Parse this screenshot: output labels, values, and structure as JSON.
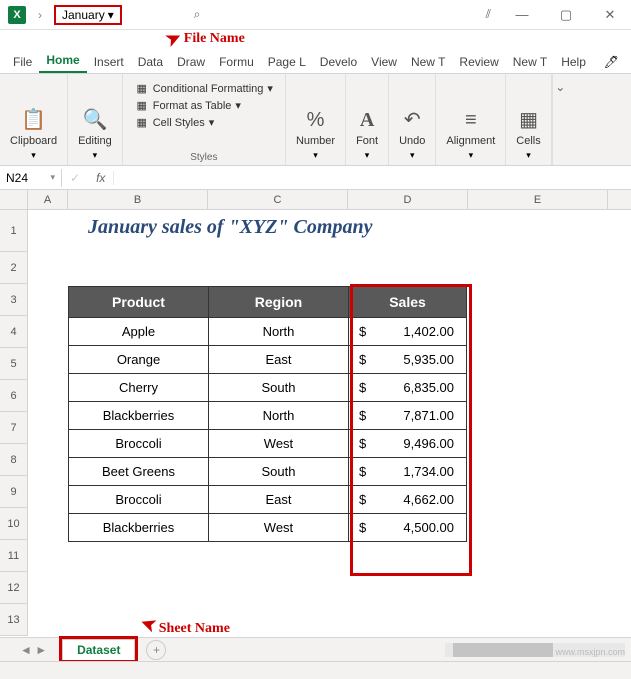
{
  "titlebar": {
    "file_name": "January",
    "annotation": "File Name"
  },
  "menu": {
    "file": "File",
    "home": "Home",
    "insert": "Insert",
    "data": "Data",
    "draw": "Draw",
    "formu": "Formu",
    "pagel": "Page L",
    "develo": "Develo",
    "view": "View",
    "newt1": "New T",
    "review": "Review",
    "newt2": "New T",
    "help": "Help"
  },
  "ribbon": {
    "clipboard": "Clipboard",
    "editing": "Editing",
    "styles": {
      "cond": "Conditional Formatting",
      "table": "Format as Table",
      "cell": "Cell Styles",
      "label": "Styles"
    },
    "number": "Number",
    "font": "Font",
    "undo": "Undo",
    "alignment": "Alignment",
    "cells": "Cells"
  },
  "namebox": "N24",
  "cols": [
    "A",
    "B",
    "C",
    "D",
    "E"
  ],
  "rows": [
    "1",
    "2",
    "3",
    "4",
    "5",
    "6",
    "7",
    "8",
    "9",
    "10",
    "11",
    "12",
    "13"
  ],
  "sheet_title": "January sales of \"XYZ\" Company",
  "table": {
    "headers": {
      "product": "Product",
      "region": "Region",
      "sales": "Sales"
    },
    "rows": [
      {
        "product": "Apple",
        "region": "North",
        "sales": "1,402.00"
      },
      {
        "product": "Orange",
        "region": "East",
        "sales": "5,935.00"
      },
      {
        "product": "Cherry",
        "region": "South",
        "sales": "6,835.00"
      },
      {
        "product": "Blackberries",
        "region": "North",
        "sales": "7,871.00"
      },
      {
        "product": "Broccoli",
        "region": "West",
        "sales": "9,496.00"
      },
      {
        "product": "Beet Greens",
        "region": "South",
        "sales": "1,734.00"
      },
      {
        "product": "Broccoli",
        "region": "East",
        "sales": "4,662.00"
      },
      {
        "product": "Blackberries",
        "region": "West",
        "sales": "4,500.00"
      }
    ]
  },
  "sheet_tab": {
    "name": "Dataset",
    "annotation": "Sheet Name"
  },
  "watermark": "www.msxjpn.com"
}
